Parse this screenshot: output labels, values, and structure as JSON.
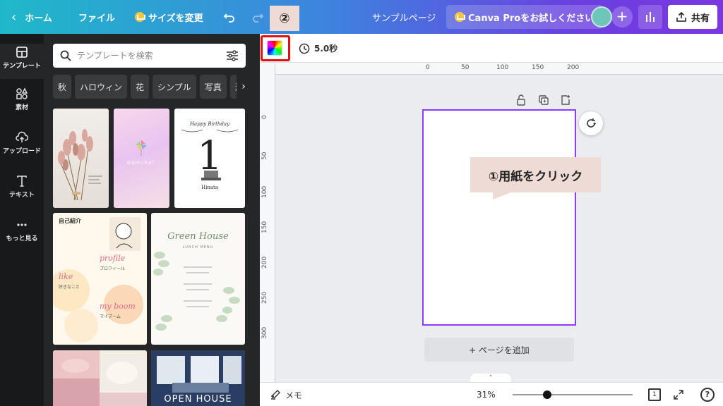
{
  "topbar": {
    "home_label": "ホーム",
    "file_label": "ファイル",
    "resize_label": "サイズを変更",
    "doc_title": "サンプルページ",
    "pro_label": "Canva Proをお試しください",
    "share_label": "共有"
  },
  "rail": {
    "items": [
      {
        "label": "テンプレート",
        "icon": "template-icon"
      },
      {
        "label": "素材",
        "icon": "elements-icon"
      },
      {
        "label": "アップロード",
        "icon": "upload-icon"
      },
      {
        "label": "テキスト",
        "icon": "text-icon"
      },
      {
        "label": "もっと見る",
        "icon": "more-icon"
      }
    ]
  },
  "panel": {
    "search_placeholder": "テンプレートを検索",
    "chips": [
      "秋",
      "ハロウィン",
      "花",
      "シンプル",
      "写真",
      "海"
    ]
  },
  "templates": {
    "t2_text": "ゆるけいちゃ？",
    "t3_title": "Happy Birthday",
    "t3_number": "1",
    "t3_name": "Hinata",
    "t4_heading": "自己紹介",
    "t4_profile": "profile",
    "t4_profile_jp": "プロフィール",
    "t4_like": "like",
    "t4_like_jp": "好きなこと",
    "t4_boom": "my boom",
    "t4_boom_jp": "マイブーム",
    "t5_title": "Green House",
    "t5_sub": "LUNCH MENU",
    "t7_text": "OPEN HOUSE"
  },
  "toolbar2": {
    "duration": "5.0秒"
  },
  "annotations": {
    "marker2": "②",
    "note1": "①用紙をクリック"
  },
  "ruler": {
    "top": [
      "0",
      "50",
      "100",
      "150",
      "200"
    ],
    "left": [
      "0",
      "50",
      "100",
      "150",
      "200",
      "250",
      "300"
    ]
  },
  "canvas": {
    "add_page_label": "+ ページを追加"
  },
  "bottombar": {
    "memo_label": "メモ",
    "zoom_label": "31%",
    "zoom_fraction": 0.29,
    "page_count": "1",
    "help_label": "?"
  },
  "colors": {
    "accent": "#8b3dff",
    "highlight_red": "#e40e0e",
    "annotation_bg": "#eedbd5"
  }
}
